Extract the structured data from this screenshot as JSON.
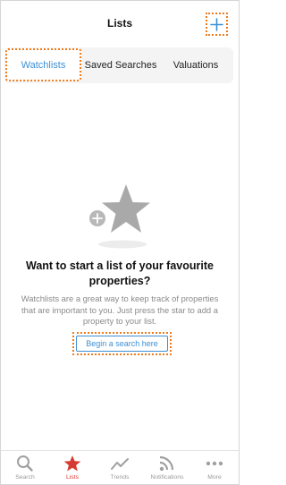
{
  "header": {
    "title": "Lists",
    "add_icon": "plus-icon"
  },
  "tabs": [
    {
      "label": "Watchlists",
      "active": true
    },
    {
      "label": "Saved Searches",
      "active": false
    },
    {
      "label": "Valuations",
      "active": false
    }
  ],
  "empty_state": {
    "illustration_icon": "star-plus-icon",
    "title": "Want to start a list of your favourite properties?",
    "description": "Watchlists are a great way to keep track of properties that are important to you. Just press the star to add a property to your list.",
    "button_label": "Begin a search here"
  },
  "bottom_nav": {
    "items": [
      {
        "label": "Search",
        "icon": "search-icon",
        "active": false
      },
      {
        "label": "Lists",
        "icon": "star-icon",
        "active": true
      },
      {
        "label": "Trends",
        "icon": "trend-line-icon",
        "active": false
      },
      {
        "label": "Notifications",
        "icon": "rss-icon",
        "active": false
      },
      {
        "label": "More",
        "icon": "more-dots-icon",
        "active": false
      }
    ]
  },
  "colors": {
    "accent_blue": "#3d8fd6",
    "active_red": "#d63a33",
    "highlight_orange": "#f07a1a",
    "muted_gray": "#9a9a9a"
  }
}
